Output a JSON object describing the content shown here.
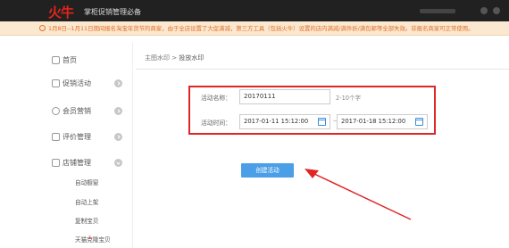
{
  "header": {
    "logo": "火牛",
    "app_title": "掌柜促销管理必备"
  },
  "notice": {
    "text": "1月8日--1月11日期间报名淘宝年货节的商家，由于全店设置了大促满减，第三方工具（包括火牛）设置的店内满减/满件折/满包邮等全部失效。非报名商家可正常使用。"
  },
  "sidebar": {
    "items": [
      {
        "label": "首页",
        "icon": "home-icon"
      },
      {
        "label": "促销活动",
        "icon": "tag-icon"
      },
      {
        "label": "会员营销",
        "icon": "user-icon"
      },
      {
        "label": "评价管理",
        "icon": "comment-icon"
      },
      {
        "label": "店铺管理",
        "icon": "shop-icon"
      }
    ],
    "sub_items": [
      "自动橱窗",
      "自动上架",
      "复制宝贝",
      "天猫克隆宝贝"
    ]
  },
  "breadcrumb": {
    "parent": "主图水印",
    "separator": ">",
    "current": "投放水印"
  },
  "form": {
    "name_label": "活动名称：",
    "name_value": "20170111",
    "name_hint": "2-10个字",
    "time_label": "活动时间：",
    "start_time": "2017-01-11 15:12:00",
    "separator": "—",
    "end_time": "2017-01-18 15:12:00"
  },
  "actions": {
    "create_label": "创建活动"
  },
  "colors": {
    "accent": "#4a9fe6",
    "highlight": "#e02525",
    "notice_text": "#e0702a",
    "brand": "#e1251b"
  }
}
